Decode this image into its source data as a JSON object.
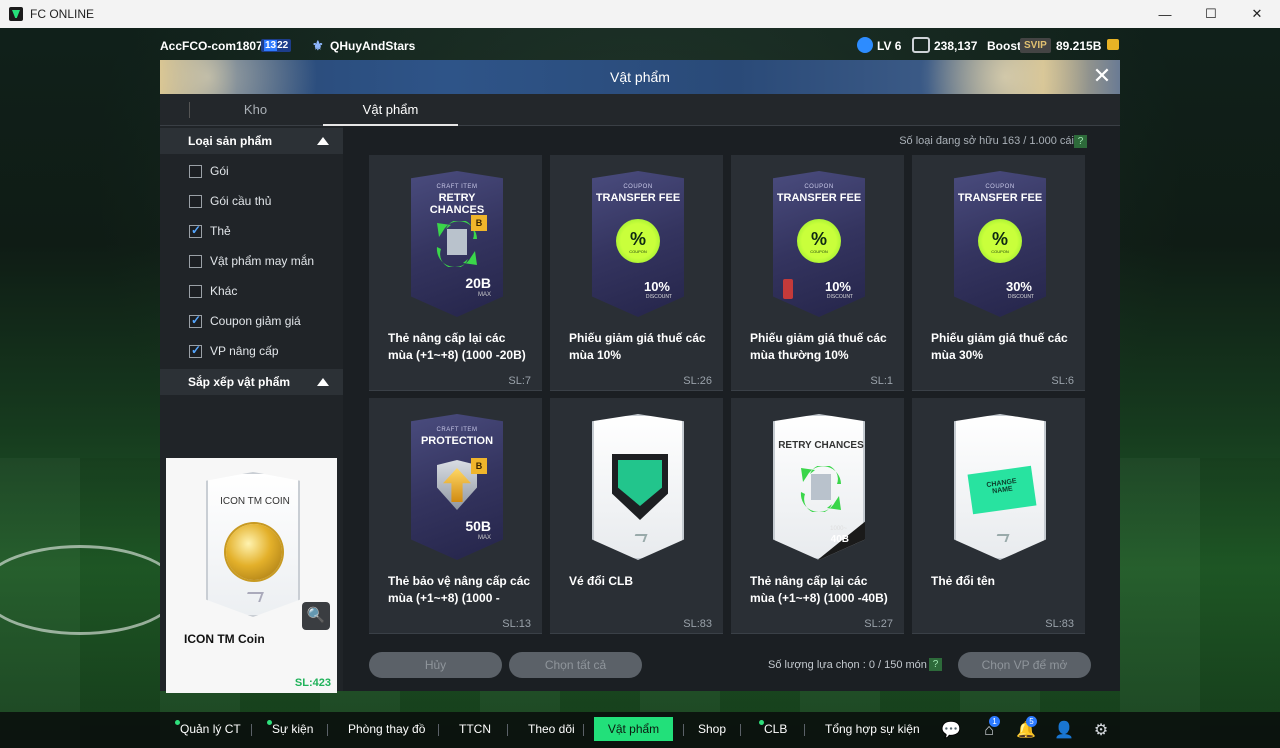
{
  "window": {
    "title": "FC ONLINE",
    "controls": {
      "minimize": "—",
      "maximize": "☐",
      "close": "✕"
    }
  },
  "topbar": {
    "account": "AccFCO-com1807c",
    "badge_a": "13",
    "badge_b": "22",
    "team": "QHuyAndStars",
    "level": "LV 6",
    "rank_value": "238,137",
    "boost_label": "Boost",
    "svip": "SVIP",
    "bp_value": "89.215B"
  },
  "dialog": {
    "title": "Vật phẩm",
    "close_icon": "✕",
    "tabs": [
      {
        "label": "Kho"
      },
      {
        "label": "Vật phẩm"
      }
    ]
  },
  "sidebar": {
    "product_type_header": "Loại sản phẩm",
    "filters": [
      {
        "label": "Gói",
        "checked": false
      },
      {
        "label": "Gói cầu thủ",
        "checked": false
      },
      {
        "label": "Thẻ",
        "checked": true
      },
      {
        "label": "Vật phẩm may mắn",
        "checked": false
      },
      {
        "label": "Khác",
        "checked": false
      },
      {
        "label": "Coupon giảm giá",
        "checked": true
      },
      {
        "label": "VP nâng cấp",
        "checked": true
      }
    ],
    "sort_header": "Sắp xếp vật phẩm",
    "preview": {
      "card_title": "ICON TM COIN",
      "name": "ICON TM Coin",
      "qty": "SL:423",
      "zoom_icon": "🔍"
    }
  },
  "main": {
    "owned_label": "Số loại đang sở hữu  163 / 1.000 cái",
    "help": "?",
    "items": [
      {
        "card_sub": "CRAFT ITEM",
        "card_title": "RETRY CHANCES",
        "grade": "B",
        "mark": "20B",
        "mark_sub": "MAX",
        "name": "Thẻ nâng cấp lại các mùa (+1~+8) (1000 -20B)",
        "qty": "SL:7"
      },
      {
        "card_sub": "COUPON",
        "card_title": "TRANSFER FEE",
        "badge": "%",
        "badge_word": "COUPON",
        "value": "10%",
        "value_label": "DISCOUNT",
        "name": "Phiếu giảm giá thuế các mùa 10%",
        "qty": "SL:26"
      },
      {
        "card_sub": "COUPON",
        "card_title": "TRANSFER FEE",
        "badge": "%",
        "badge_word": "COUPON",
        "value": "10%",
        "value_label": "DISCOUNT",
        "name": "Phiếu giảm giá thuế các mùa thường 10%",
        "qty": "SL:1"
      },
      {
        "card_sub": "COUPON",
        "card_title": "TRANSFER FEE",
        "badge": "%",
        "badge_word": "COUPON",
        "value": "30%",
        "value_label": "DISCOUNT",
        "name": "Phiếu giảm giá thuế các mùa 30%",
        "qty": "SL:6"
      },
      {
        "card_sub": "CRAFT ITEM",
        "card_title": "PROTECTION",
        "grade": "B",
        "mark": "50B",
        "mark_sub": "MAX",
        "name": "Thẻ bảo vệ nâng cấp các mùa (+1~+8) (1000 -",
        "qty": "SL:13"
      },
      {
        "name": "Vé đổi CLB",
        "qty": "SL:83"
      },
      {
        "card_title": "RETRY CHANCES",
        "corner_sub": "1000~",
        "corner_val": "40B",
        "name": "Thẻ nâng cấp lại các mùa (+1~+8) (1000 -40B)",
        "qty": "SL:27"
      },
      {
        "ticket_text": "CHANGE NAME",
        "name": "Thẻ đổi tên",
        "qty": "SL:83"
      }
    ],
    "actions": {
      "cancel": "Hủy",
      "select_all": "Chọn tất cả",
      "selection_count": "Số lượng lựa chọn : 0 / 150 món",
      "help": "?",
      "open_selected": "Chọn VP để mở"
    }
  },
  "bottom_nav": {
    "items": [
      {
        "label": "Quản lý CT"
      },
      {
        "label": "Sự kiện"
      },
      {
        "label": "Phòng thay đồ"
      },
      {
        "label": "TTCN"
      },
      {
        "label": "Theo dõi"
      },
      {
        "label": "Vật phẩm"
      },
      {
        "label": "Shop"
      },
      {
        "label": "CLB"
      },
      {
        "label": "Tổng hợp sự kiện"
      }
    ],
    "icons": {
      "chat": "💬",
      "home": "⌂",
      "home_badge": "1",
      "bell": "🔔",
      "bell_badge": "5",
      "person": "👤",
      "settings": "⚙"
    }
  }
}
